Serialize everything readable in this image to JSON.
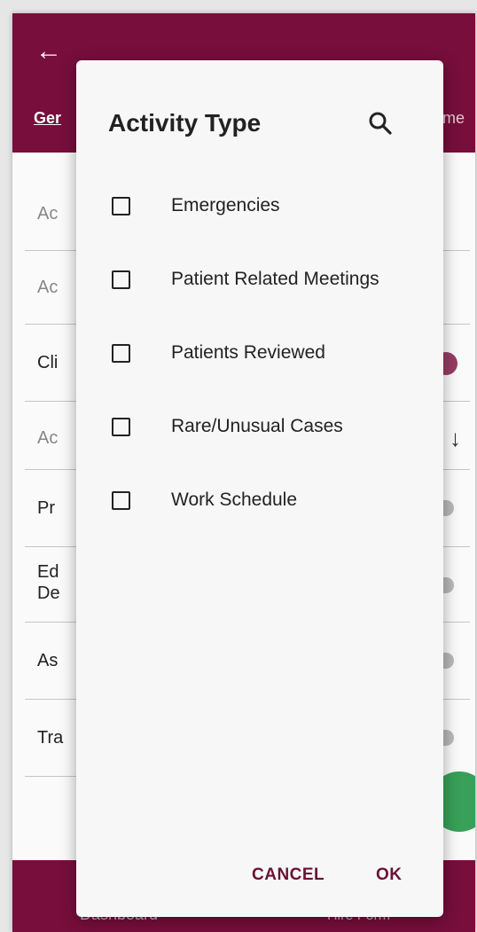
{
  "background": {
    "tab_left": "Ger",
    "tab_right": "chme",
    "rows": [
      {
        "label": "Ac",
        "muted": true,
        "control": "none"
      },
      {
        "label": "Ac",
        "muted": true,
        "control": "none"
      },
      {
        "label": "Cli",
        "muted": false,
        "control": "toggle-on"
      },
      {
        "label": "Ac",
        "muted": true,
        "control": "arrow"
      },
      {
        "label": "Pr",
        "muted": false,
        "control": "toggle-off"
      },
      {
        "label": "Ed\nDe",
        "muted": false,
        "control": "toggle-off"
      },
      {
        "label": "As",
        "muted": false,
        "control": "toggle-off"
      },
      {
        "label": "Tra",
        "muted": false,
        "control": "toggle-off"
      }
    ],
    "bottom_nav": {
      "left": "Dashboard",
      "right": "Hire Form"
    }
  },
  "dialog": {
    "title": "Activity Type",
    "options": [
      {
        "label": "Emergencies",
        "checked": false
      },
      {
        "label": "Patient Related Meetings",
        "checked": false
      },
      {
        "label": "Patients Reviewed",
        "checked": false
      },
      {
        "label": "Rare/Unusual Cases",
        "checked": false
      },
      {
        "label": "Work Schedule",
        "checked": false
      }
    ],
    "cancel_label": "CANCEL",
    "ok_label": "OK"
  },
  "colors": {
    "primary": "#7a0f3e",
    "accent_button_text": "#6b1236",
    "fab": "#3aa45a"
  }
}
